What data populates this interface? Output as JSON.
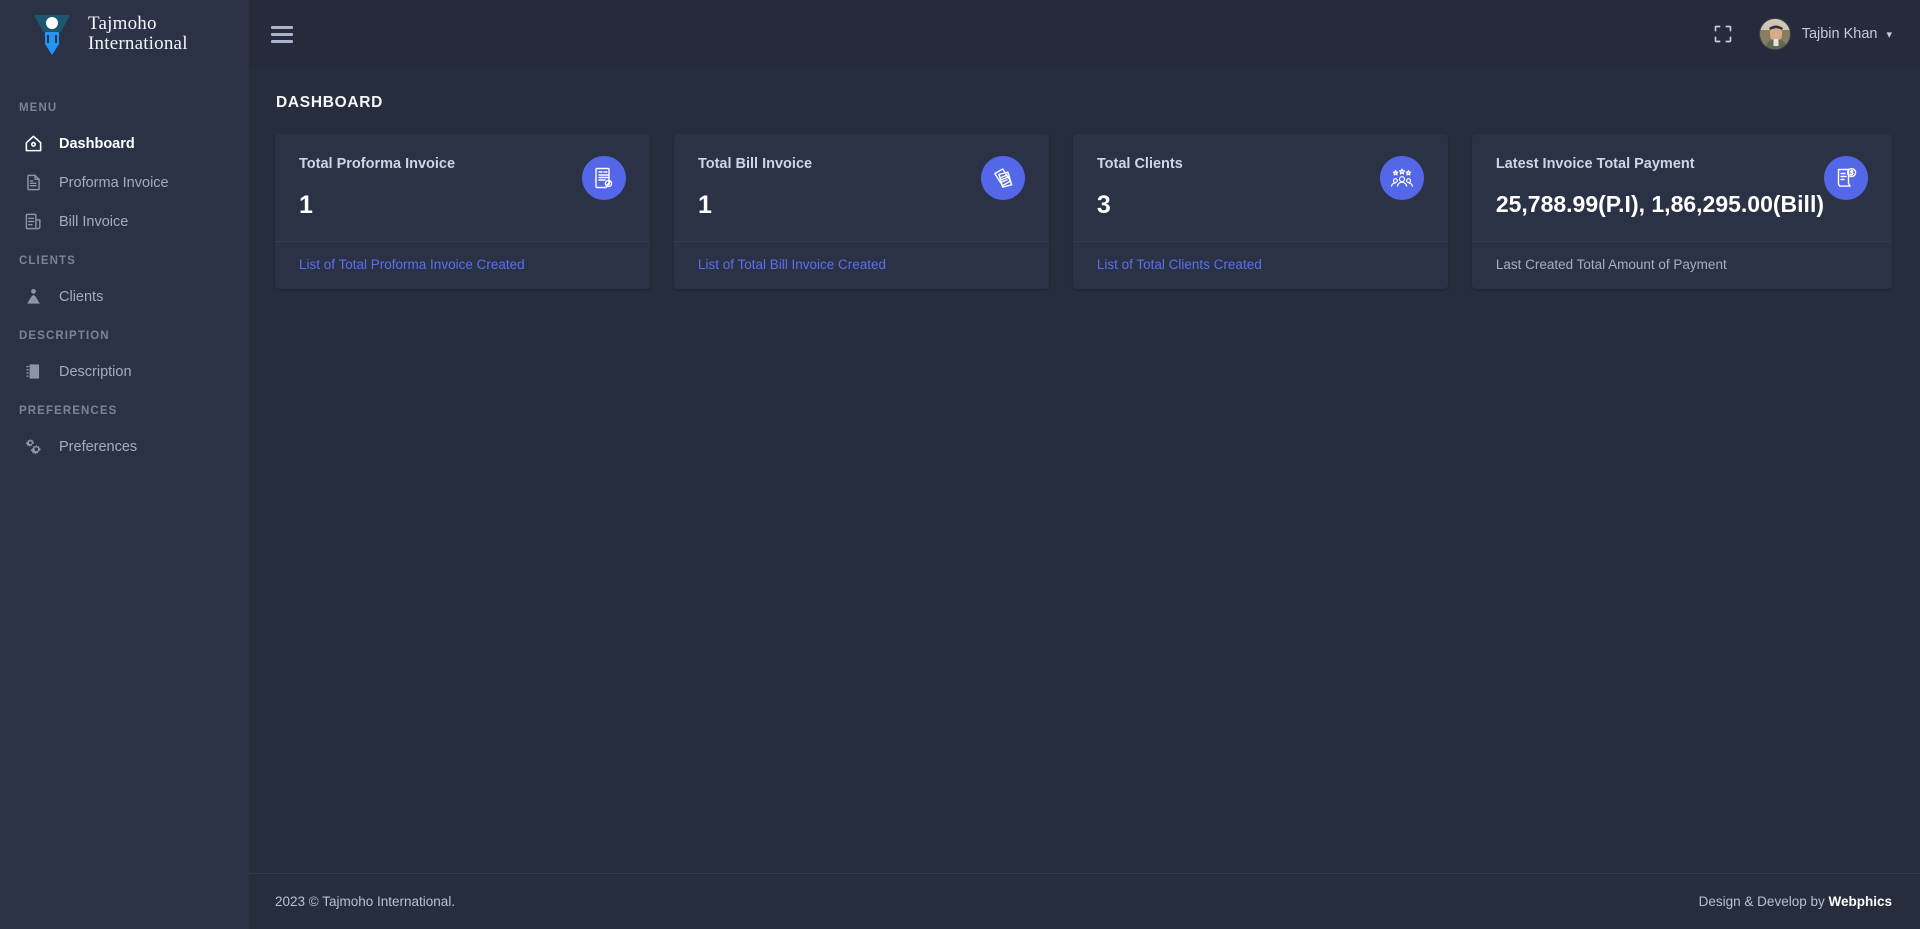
{
  "brand": {
    "line1": "Tajmoho",
    "line2": "International",
    "logo_icon": "tajmoho-logo-icon",
    "logo_colors": {
      "bar": "#1c5670",
      "stem": "#2196f3",
      "dot": "#ffffff"
    }
  },
  "sidebar": {
    "sections": [
      {
        "caption": "MENU",
        "items": [
          {
            "label": "Dashboard",
            "icon": "home-icon",
            "active": true
          },
          {
            "label": "Proforma Invoice",
            "icon": "document-icon",
            "active": false
          },
          {
            "label": "Bill Invoice",
            "icon": "receipt-icon",
            "active": false
          }
        ]
      },
      {
        "caption": "CLIENTS",
        "items": [
          {
            "label": "Clients",
            "icon": "user-tie-icon",
            "active": false
          }
        ]
      },
      {
        "caption": "DESCRIPTION",
        "items": [
          {
            "label": "Description",
            "icon": "notebook-icon",
            "active": false
          }
        ]
      },
      {
        "caption": "PREFERENCES",
        "items": [
          {
            "label": "Preferences",
            "icon": "cogs-icon",
            "active": false
          }
        ]
      }
    ]
  },
  "topbar": {
    "menu_toggle_icon": "hamburger-icon",
    "fullscreen_icon": "fullscreen-expand-icon",
    "user_name": "Tajbin Khan",
    "user_caret_icon": "chevron-down-icon",
    "avatar_icon": "user-avatar-photo"
  },
  "page": {
    "title": "DASHBOARD"
  },
  "cards": [
    {
      "label": "Total Proforma Invoice",
      "value": "1",
      "icon": "invoice-document-icon",
      "link": "List of Total Proforma Invoice Created",
      "link_is_action": true
    },
    {
      "label": "Total Bill Invoice",
      "value": "1",
      "icon": "stacked-invoices-icon",
      "link": "List of Total Bill Invoice Created",
      "link_is_action": true
    },
    {
      "label": "Total Clients",
      "value": "3",
      "icon": "clients-group-icon",
      "link": "List of Total Clients Created",
      "link_is_action": true
    },
    {
      "label": "Latest Invoice Total Payment",
      "value": "25,788.99(P.I), 1,86,295.00(Bill)",
      "icon": "invoice-dollar-icon",
      "link": "Last Created Total Amount of Payment",
      "link_is_action": false
    }
  ],
  "footer": {
    "copyright": "2023 © Tajmoho International.",
    "credit_prefix": "Design & Develop by ",
    "credit_brand": "Webphics"
  },
  "theme": {
    "accent": "#5367e8",
    "link": "#5b6ef0",
    "sidebar_bg": "#2b3245",
    "page_bg": "#262d3d",
    "card_bg": "#2b3245"
  }
}
